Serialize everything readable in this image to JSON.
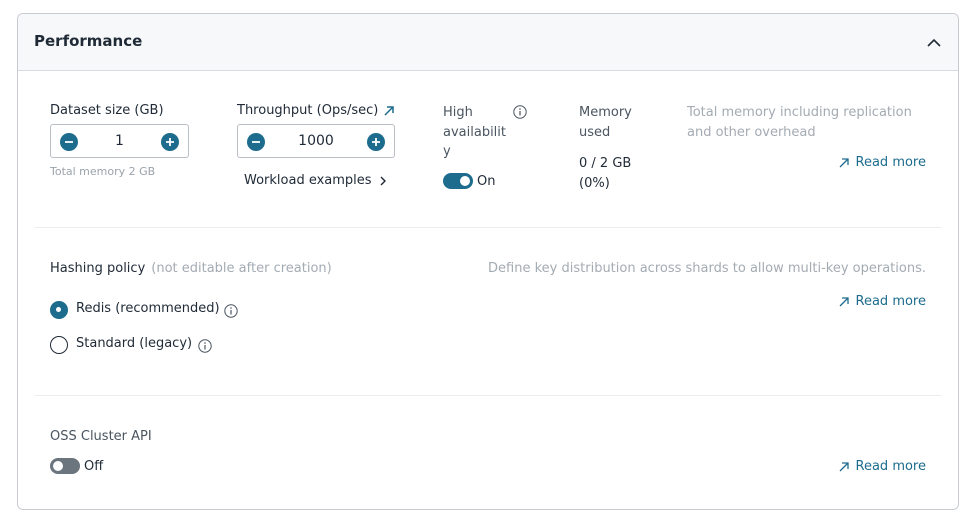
{
  "header": {
    "title": "Performance"
  },
  "dataset": {
    "label": "Dataset size (GB)",
    "value": "1",
    "hint": "Total memory 2 GB"
  },
  "throughput": {
    "label": "Throughput (Ops/sec)",
    "value": "1000",
    "workload_link": "Workload examples"
  },
  "high_availability": {
    "label_lines": [
      "High",
      "availabilit",
      "y"
    ],
    "state": "On"
  },
  "memory": {
    "label_lines": [
      "Memory",
      "used"
    ],
    "value_lines": [
      "0 / 2 GB",
      "(0%)"
    ],
    "description_lines": [
      "Total memory including replication",
      "and other overhead"
    ],
    "read_more": "Read more"
  },
  "hashing": {
    "label": "Hashing policy",
    "note": "(not editable after creation)",
    "description": "Define key distribution across shards to allow multi-key operations.",
    "read_more": "Read more",
    "options": [
      {
        "label": "Redis (recommended)",
        "selected": true
      },
      {
        "label": "Standard (legacy)",
        "selected": false
      }
    ]
  },
  "oss": {
    "label": "OSS Cluster API",
    "state": "Off",
    "read_more": "Read more"
  },
  "colors": {
    "accent": "#1d6c8e",
    "toggle_off": "#6b757e",
    "text": "#1f2a36",
    "muted": "#a3abb3"
  },
  "icons": [
    "chevron-up-icon",
    "minus-icon",
    "plus-icon",
    "external-link-icon",
    "chevron-right-icon",
    "info-icon",
    "arrow-up-right-icon"
  ]
}
